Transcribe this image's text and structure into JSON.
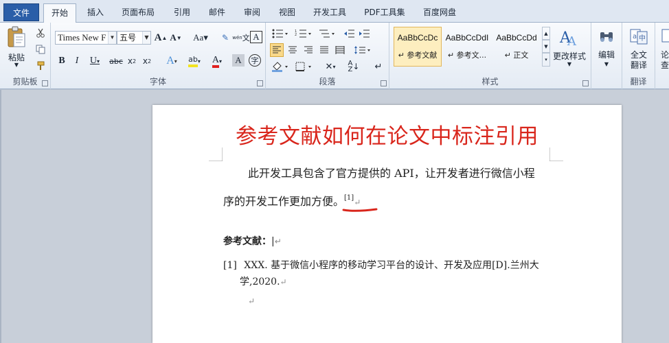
{
  "tabs": {
    "file": "文件",
    "items": [
      "开始",
      "插入",
      "页面布局",
      "引用",
      "邮件",
      "审阅",
      "视图",
      "开发工具",
      "PDF工具集",
      "百度网盘"
    ]
  },
  "ribbon": {
    "clipboard": {
      "paste": "粘贴",
      "label": "剪贴板"
    },
    "font": {
      "name": "Times New F",
      "size": "五号",
      "label": "字体"
    },
    "paragraph": {
      "label": "段落"
    },
    "styles": {
      "label": "样式",
      "items": [
        {
          "sample": "AaBbCcDc",
          "name": "↵ 参考文献"
        },
        {
          "sample": "AaBbCcDdI",
          "name": "↵ 参考文..."
        },
        {
          "sample": "AaBbCcDd",
          "name": "↵ 正文"
        }
      ],
      "change": "更改样式"
    },
    "edit": {
      "label": "编辑"
    },
    "translate": {
      "full": "全文",
      "full2": "翻译",
      "label": "翻译"
    },
    "extra": {
      "char1": "论",
      "char2": "查"
    }
  },
  "document": {
    "title": "参考文献如何在论文中标注引用",
    "para_line1": "此开发工具包含了官方提供的 API，让开发者进行微信小程",
    "para_line2": "序的开发工作更加方便。",
    "citation": "[1]",
    "ref_heading": "参考文献：",
    "ref_number": "[1]",
    "ref_line1": "XXX. 基于微信小程序的移动学习平台的设计、开发及应用[D].兰州大",
    "ref_line2": "学,2020."
  },
  "colors": {
    "accent": "#2a5ea8",
    "title": "#d9261c",
    "underline": "#d9261c"
  }
}
